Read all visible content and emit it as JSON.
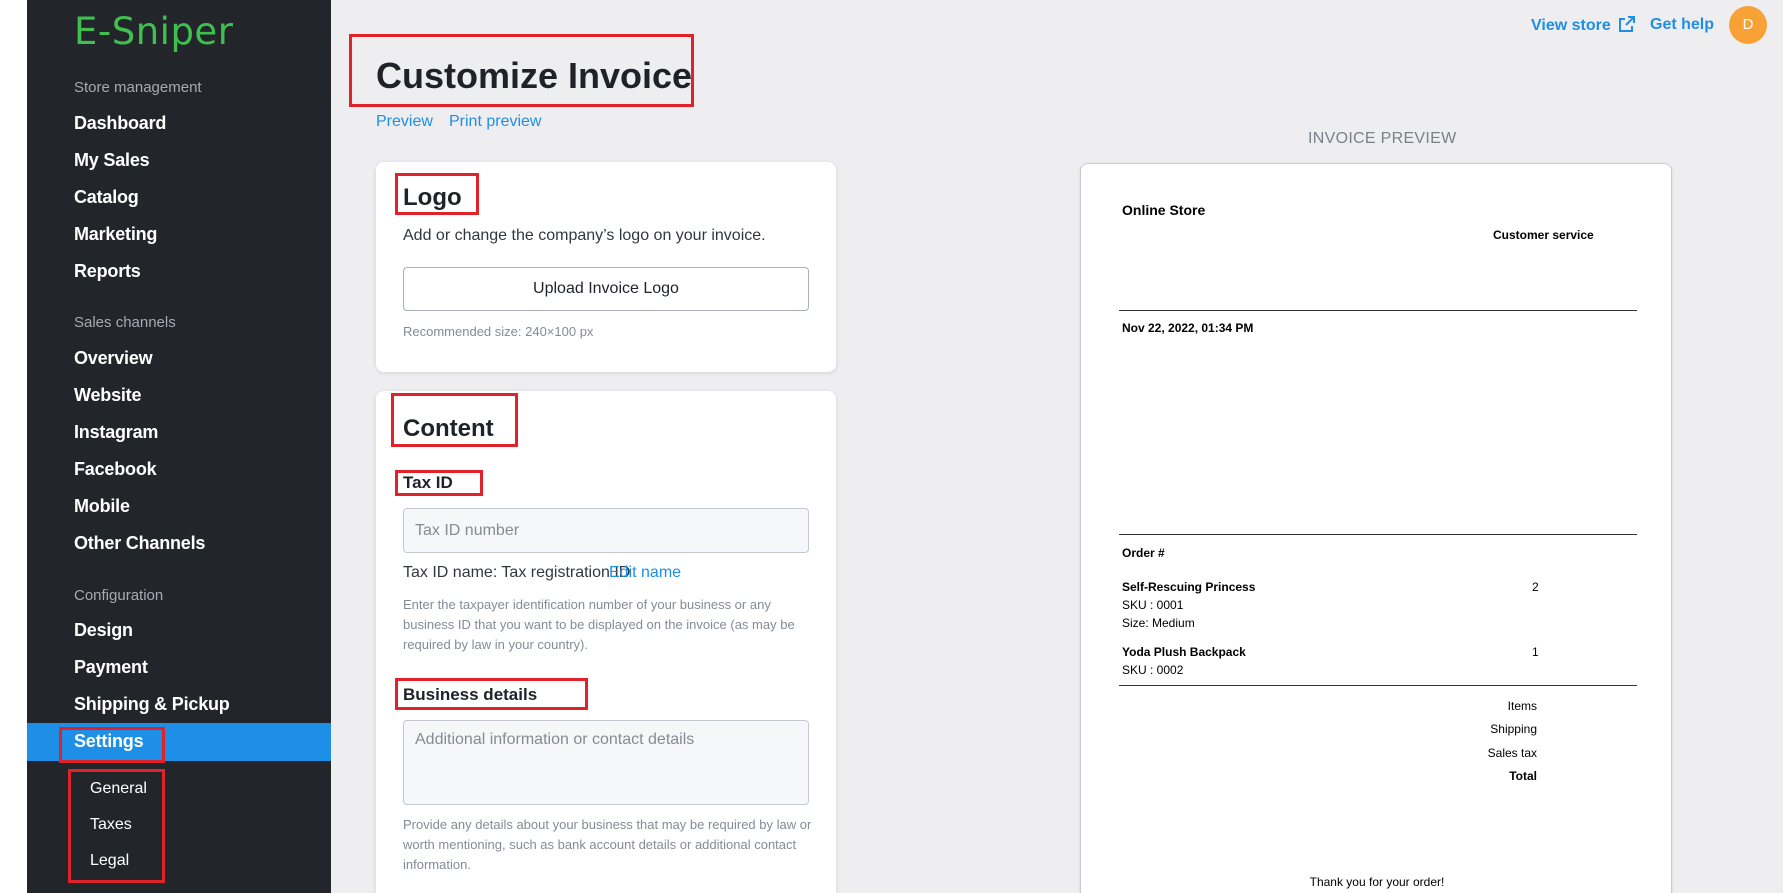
{
  "brand": {
    "name": "E-Sniper",
    "color": "#3fbf4f"
  },
  "sidebar": {
    "store_management_label": "Store management",
    "store_items": [
      "Dashboard",
      "My Sales",
      "Catalog",
      "Marketing",
      "Reports"
    ],
    "sales_channels_label": "Sales channels",
    "channel_items": [
      "Overview",
      "Website",
      "Instagram",
      "Facebook",
      "Mobile",
      "Other Channels"
    ],
    "configuration_label": "Configuration",
    "config_items": [
      "Design",
      "Payment",
      "Shipping & Pickup",
      "Settings"
    ],
    "settings_sub_items": [
      "General",
      "Taxes",
      "Legal"
    ],
    "active_item": "Settings",
    "accent": "#1e8fe6"
  },
  "topbar": {
    "view_store": "View store",
    "get_help": "Get help",
    "avatar_initial": "D"
  },
  "page": {
    "title": "Customize Invoice",
    "preview_link": "Preview",
    "print_preview_link": "Print preview"
  },
  "logo_card": {
    "heading": "Logo",
    "description": "Add or change the company’s logo on your invoice.",
    "upload_button": "Upload Invoice Logo",
    "hint": "Recommended size: 240×100 px"
  },
  "content_card": {
    "heading": "Content",
    "tax_id": {
      "label": "Tax ID",
      "placeholder": "Tax ID number",
      "name_text": "Tax ID name: Tax registration ID",
      "edit_link": "Edit name",
      "hint": "Enter the taxpayer identification number of your business or any business ID that you want to be displayed on the invoice (as may be required by law in your country)."
    },
    "business_details": {
      "label": "Business details",
      "placeholder": "Additional information or contact details",
      "hint": "Provide any details about your business that may be required by law or worth mentioning, such as bank account details or additional contact information."
    }
  },
  "invoice_preview": {
    "label": "INVOICE PREVIEW",
    "store_name": "Online Store",
    "customer_service": "Customer service",
    "date": "Nov 22, 2022, 01:34 PM",
    "order_label": "Order #",
    "items": [
      {
        "name": "Self-Rescuing Princess",
        "sku": "SKU : 0001",
        "option": "Size: Medium",
        "qty": "2"
      },
      {
        "name": "Yoda Plush Backpack",
        "sku": "SKU : 0002",
        "option": "",
        "qty": "1"
      }
    ],
    "totals": [
      "Items",
      "Shipping",
      "Sales tax",
      "Total"
    ],
    "thank_you": "Thank you for your order!"
  },
  "highlight_color": "#e0222a"
}
